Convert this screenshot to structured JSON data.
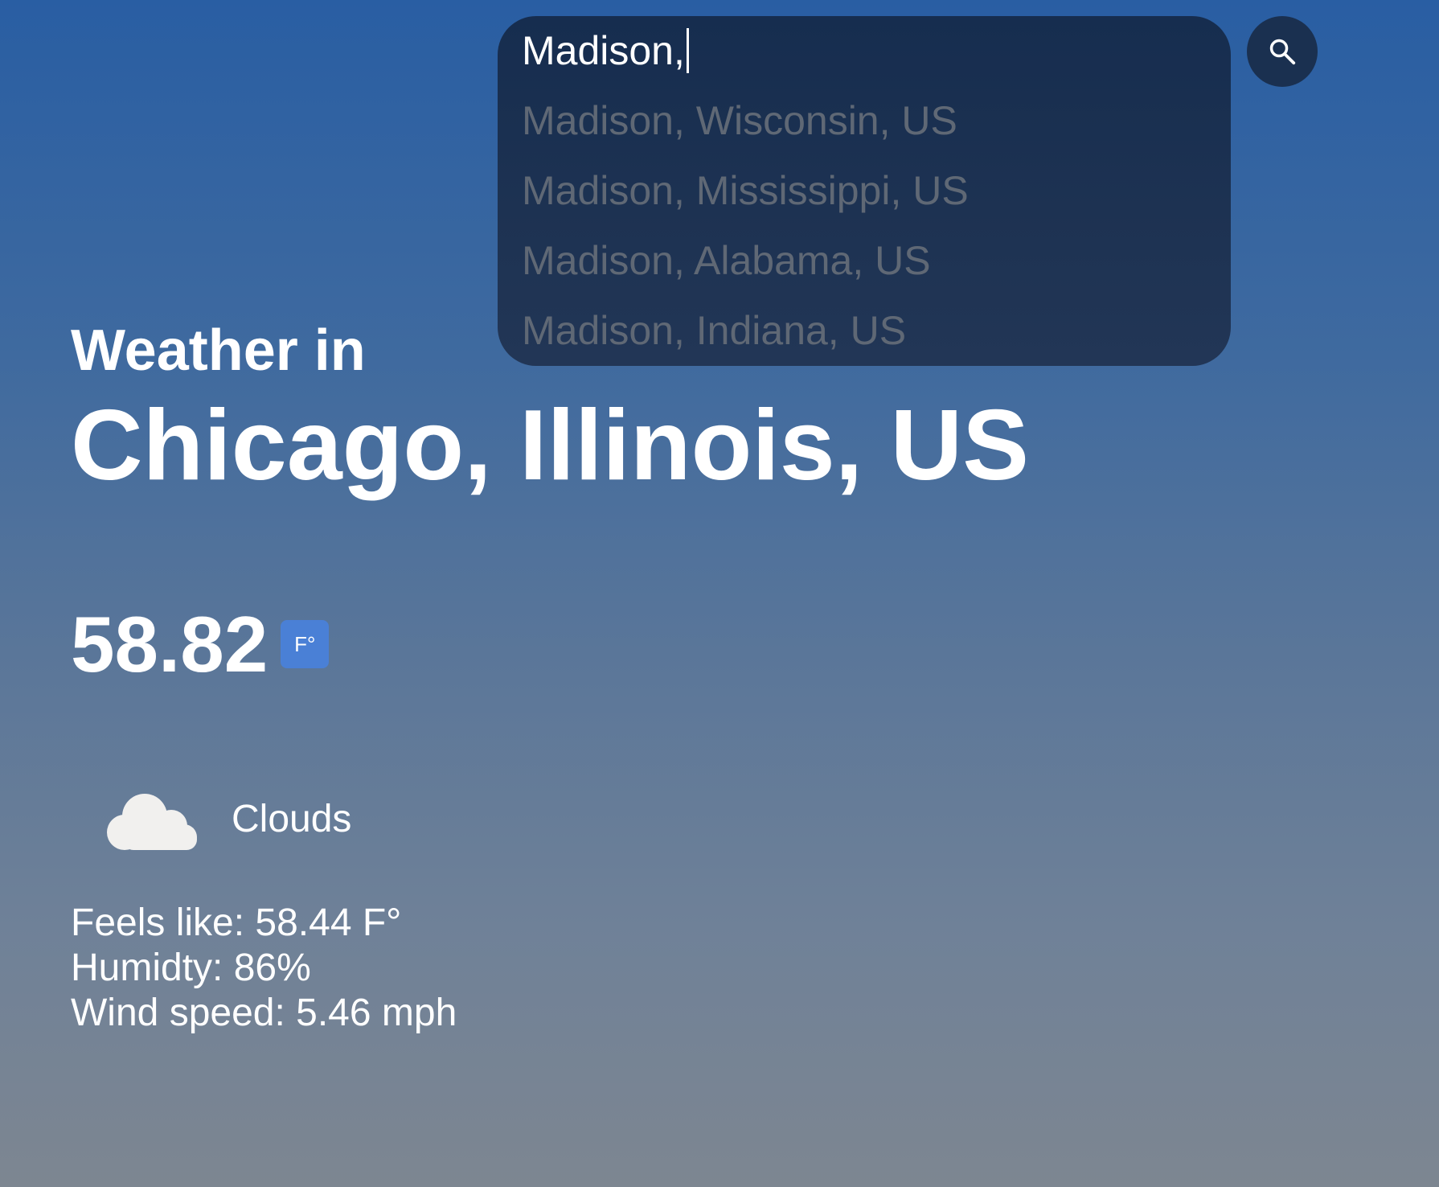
{
  "search": {
    "value": "Madison,",
    "suggestions": [
      "Madison, Wisconsin, US",
      "Madison, Mississippi, US",
      "Madison, Alabama, US",
      "Madison, Indiana, US"
    ],
    "button_icon": "search-icon"
  },
  "weather": {
    "heading": "Weather in",
    "location": "Chicago, Illinois, US",
    "temperature": "58.82",
    "unit_label": "F°",
    "condition_icon": "cloud-icon",
    "condition": "Clouds",
    "feels_like": "Feels like: 58.44 F°",
    "humidity": "Humidty: 86%",
    "wind_speed": "Wind speed: 5.46 mph"
  },
  "colors": {
    "background_top": "#295ea3",
    "background_bottom": "#7d8691",
    "panel": "#1a3050",
    "unit_button": "#4a80d6",
    "suggestion_text": "#5f6875"
  }
}
